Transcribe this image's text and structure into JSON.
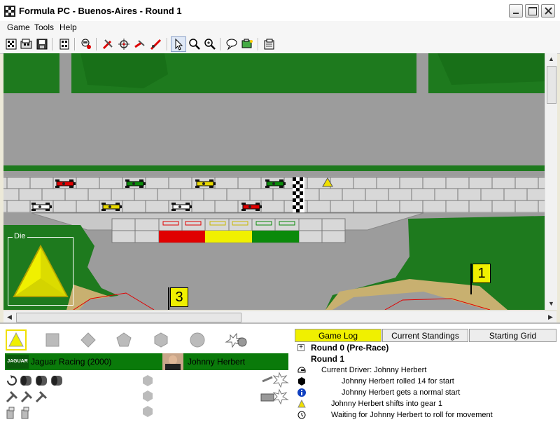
{
  "window": {
    "title": "Formula PC - Buenos-Aires - Round 1",
    "icon": "checkered-flag-icon"
  },
  "menu": {
    "items": [
      "Game",
      "Tools",
      "Help"
    ]
  },
  "toolbar": {
    "icons": [
      "new-game-icon",
      "open-game-icon",
      "save-game-icon",
      "grid-icon",
      "driver-icon",
      "pit-icon",
      "target-icon",
      "wrench-icon",
      "tire-icon",
      "pointer-icon",
      "zoom-in-icon",
      "zoom-fit-icon",
      "chat-icon",
      "camera-icon",
      "settings-icon"
    ]
  },
  "track": {
    "flags": [
      {
        "label": "1"
      },
      {
        "label": "3"
      }
    ],
    "cars": [
      {
        "color": "#e00000"
      },
      {
        "color": "#0a8a0a"
      },
      {
        "color": "#e8d800"
      },
      {
        "color": "#0a8a0a"
      },
      {
        "color": "#ffffff"
      },
      {
        "color": "#e8d800"
      },
      {
        "color": "#ffffff"
      },
      {
        "color": "#e00000"
      }
    ]
  },
  "die": {
    "label": "Die",
    "shape": "triangle",
    "color": "#f0f000"
  },
  "dice_selector": {
    "shapes": [
      "triangle",
      "square",
      "diamond",
      "pentagon",
      "hexagon",
      "circle"
    ]
  },
  "team": {
    "logo_text": "JAGUAR",
    "name": "Jaguar Racing (2000)",
    "driver": "Johnny Herbert"
  },
  "tabs": [
    {
      "label": "Game Log",
      "active": true
    },
    {
      "label": "Current Standings",
      "active": false
    },
    {
      "label": "Starting Grid",
      "active": false
    }
  ],
  "log": [
    {
      "icon": "expand-icon",
      "text": "Round 0 (Pre-Race)",
      "bold": true
    },
    {
      "icon": "",
      "text": "Round 1",
      "bold": true
    },
    {
      "icon": "helmet-icon",
      "text": "Current Driver: Johnny Herbert",
      "bold": false
    },
    {
      "icon": "die-icon",
      "text": "Johnny Herbert rolled 14 for start",
      "bold": false
    },
    {
      "icon": "info-icon",
      "text": "Johnny Herbert gets a normal start",
      "bold": false
    },
    {
      "icon": "warning-triangle-icon",
      "text": "Johnny Herbert shifts into gear 1",
      "bold": false
    },
    {
      "icon": "clock-icon",
      "text": "Waiting for Johnny Herbert to roll for movement",
      "bold": false
    }
  ],
  "colors": {
    "grass": "#1e7a1e",
    "asphalt": "#9c9c9c",
    "team_bar": "#0a7a0a",
    "active_tab": "#f0f000"
  }
}
